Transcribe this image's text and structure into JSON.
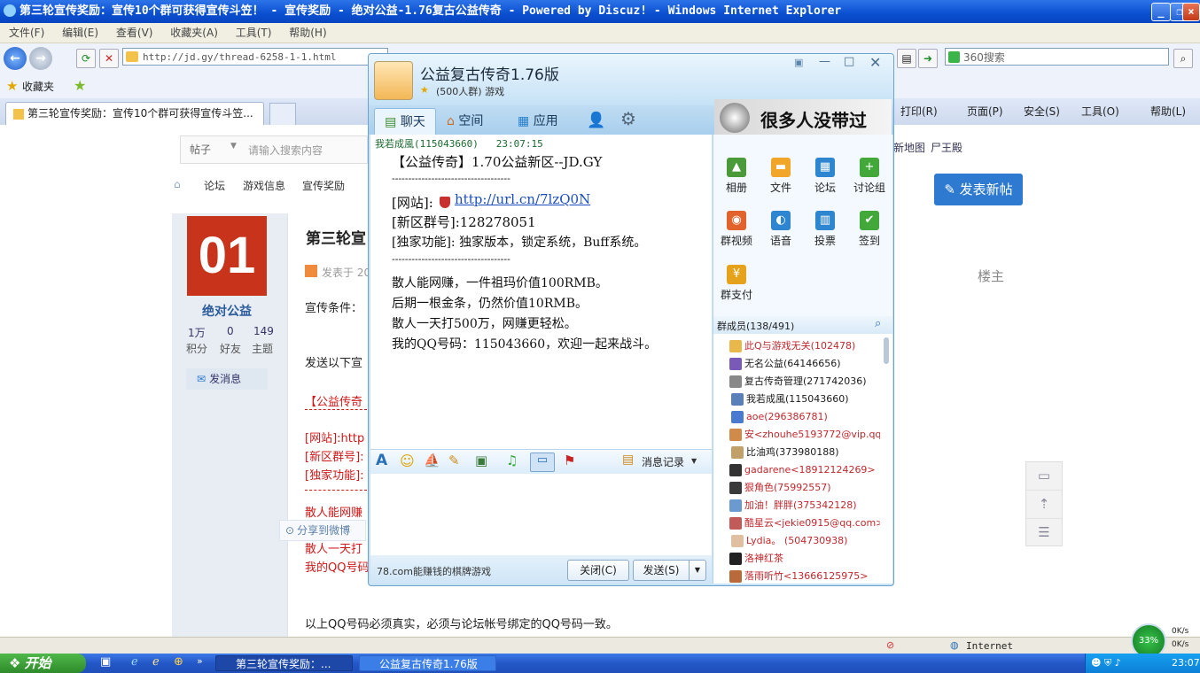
{
  "ie": {
    "title": "第三轮宣传奖励：宣传10个群可获得宣传斗笠！ - 宣传奖励 - 绝对公益-1.76复古公益传奇 - Powered by Discuz! - Windows Internet Explorer",
    "menu": [
      "文件(F)",
      "编辑(E)",
      "查看(V)",
      "收藏夹(A)",
      "工具(T)",
      "帮助(H)"
    ],
    "address": "http://jd.gy/thread-6258-1-1.html",
    "search_placeholder": "360搜索",
    "favorites_label": "收藏夹",
    "tab_title": "第三轮宣传奖励：宣传10个群可获得宣传斗笠...",
    "commands": [
      "打印(R)",
      "页面(P)",
      "安全(S)",
      "工具(O)",
      "帮助(L)"
    ],
    "status_zone": "Internet"
  },
  "forum": {
    "search_type": "帖子",
    "search_placeholder": "请输入搜索内容",
    "top_links": [
      "新地图",
      "尸王殿"
    ],
    "breadcrumb": [
      "论坛",
      "游戏信息",
      "宣传奖励"
    ],
    "new_post_button": "发表新帖",
    "post_title": "第三轮宣",
    "avatar_text": "01",
    "username": "绝对公益",
    "stats": [
      {
        "value": "1万",
        "label": "积分"
      },
      {
        "value": "0",
        "label": "好友"
      },
      {
        "value": "149",
        "label": "主题"
      }
    ],
    "send_message": "发消息",
    "posted_at": "发表于 20",
    "floor": "楼主",
    "body_lines": [
      "宣传条件：",
      "发送以下宣",
      "【公益传奇",
      "[网站]:http",
      "[新区群号]:",
      "[独家功能]:",
      "散人能网赚",
      "散人一天打",
      "我的QQ号码"
    ],
    "share_weibo": "分享到微博",
    "footer_line": "以上QQ号码必须真实，必须与论坛帐号绑定的QQ号码一致。"
  },
  "qq": {
    "group_name": "公益复古传奇1.76版",
    "group_info": "(500人群) 游戏",
    "tabs": [
      "聊天",
      "空间",
      "应用"
    ],
    "banner_text": "很多人没带过",
    "sender": "我若成風(115043660)   23:07:15",
    "message_lines": [
      "【公益传奇】1.70公益新区--JD.GY",
      "------------------------------------",
      "[网站]:",
      "[新区群号]:128278051",
      "[独家功能]: 独家版本，锁定系统，Buff系统。",
      "------------------------------------",
      "散人能网赚，一件祖玛价值100RMB。",
      "后期一根金条，仍然价值10RMB。",
      "散人一天打500万，网赚更轻松。",
      "我的QQ号码：115043660，欢迎一起来战斗。"
    ],
    "message_link": "http://url.cn/7lzQ0N",
    "history_label": "消息记录",
    "ad_text": "78.com能赚钱的棋牌游戏",
    "close_button": "关闭(C)",
    "send_button": "发送(S)",
    "apps": [
      "相册",
      "文件",
      "论坛",
      "讨论组",
      "群视频",
      "语音",
      "投票",
      "签到",
      "群支付"
    ],
    "members_header": "群成员(138/491)",
    "members": [
      "此Q与游戏无关(102478)",
      "无名公益(64146656)",
      "复古传奇管理(271742036)",
      "我若成風(115043660)",
      "aoe(296386781)",
      "安<zhouhe5193772@vip.qq...",
      "比油鸡(373980188)",
      "gadarene<18912124269>",
      "狠角色(75992557)",
      "加油！胖胖(375342128)",
      "酷星云<jekie0915@qq.com>",
      "Lydia。    (504730938)",
      "洛神红茶",
      "落雨听竹<13666125975>"
    ],
    "member_colors": [
      "#c0282d",
      "#1a1a1a",
      "#1a1a1a",
      "#1a1a1a",
      "#c0282d",
      "#c0282d",
      "#1a1a1a",
      "#c0282d",
      "#c0282d",
      "#c0282d",
      "#c0282d",
      "#c0282d",
      "#c0282d",
      "#c0282d"
    ]
  },
  "taskbar": {
    "start": "开始",
    "items": [
      "第三轮宣传奖励：...",
      "公益复古传奇1.76版"
    ],
    "clock": "23:07",
    "net_percent": "33%",
    "net_up": "0K/s",
    "net_down": "0K/s"
  }
}
